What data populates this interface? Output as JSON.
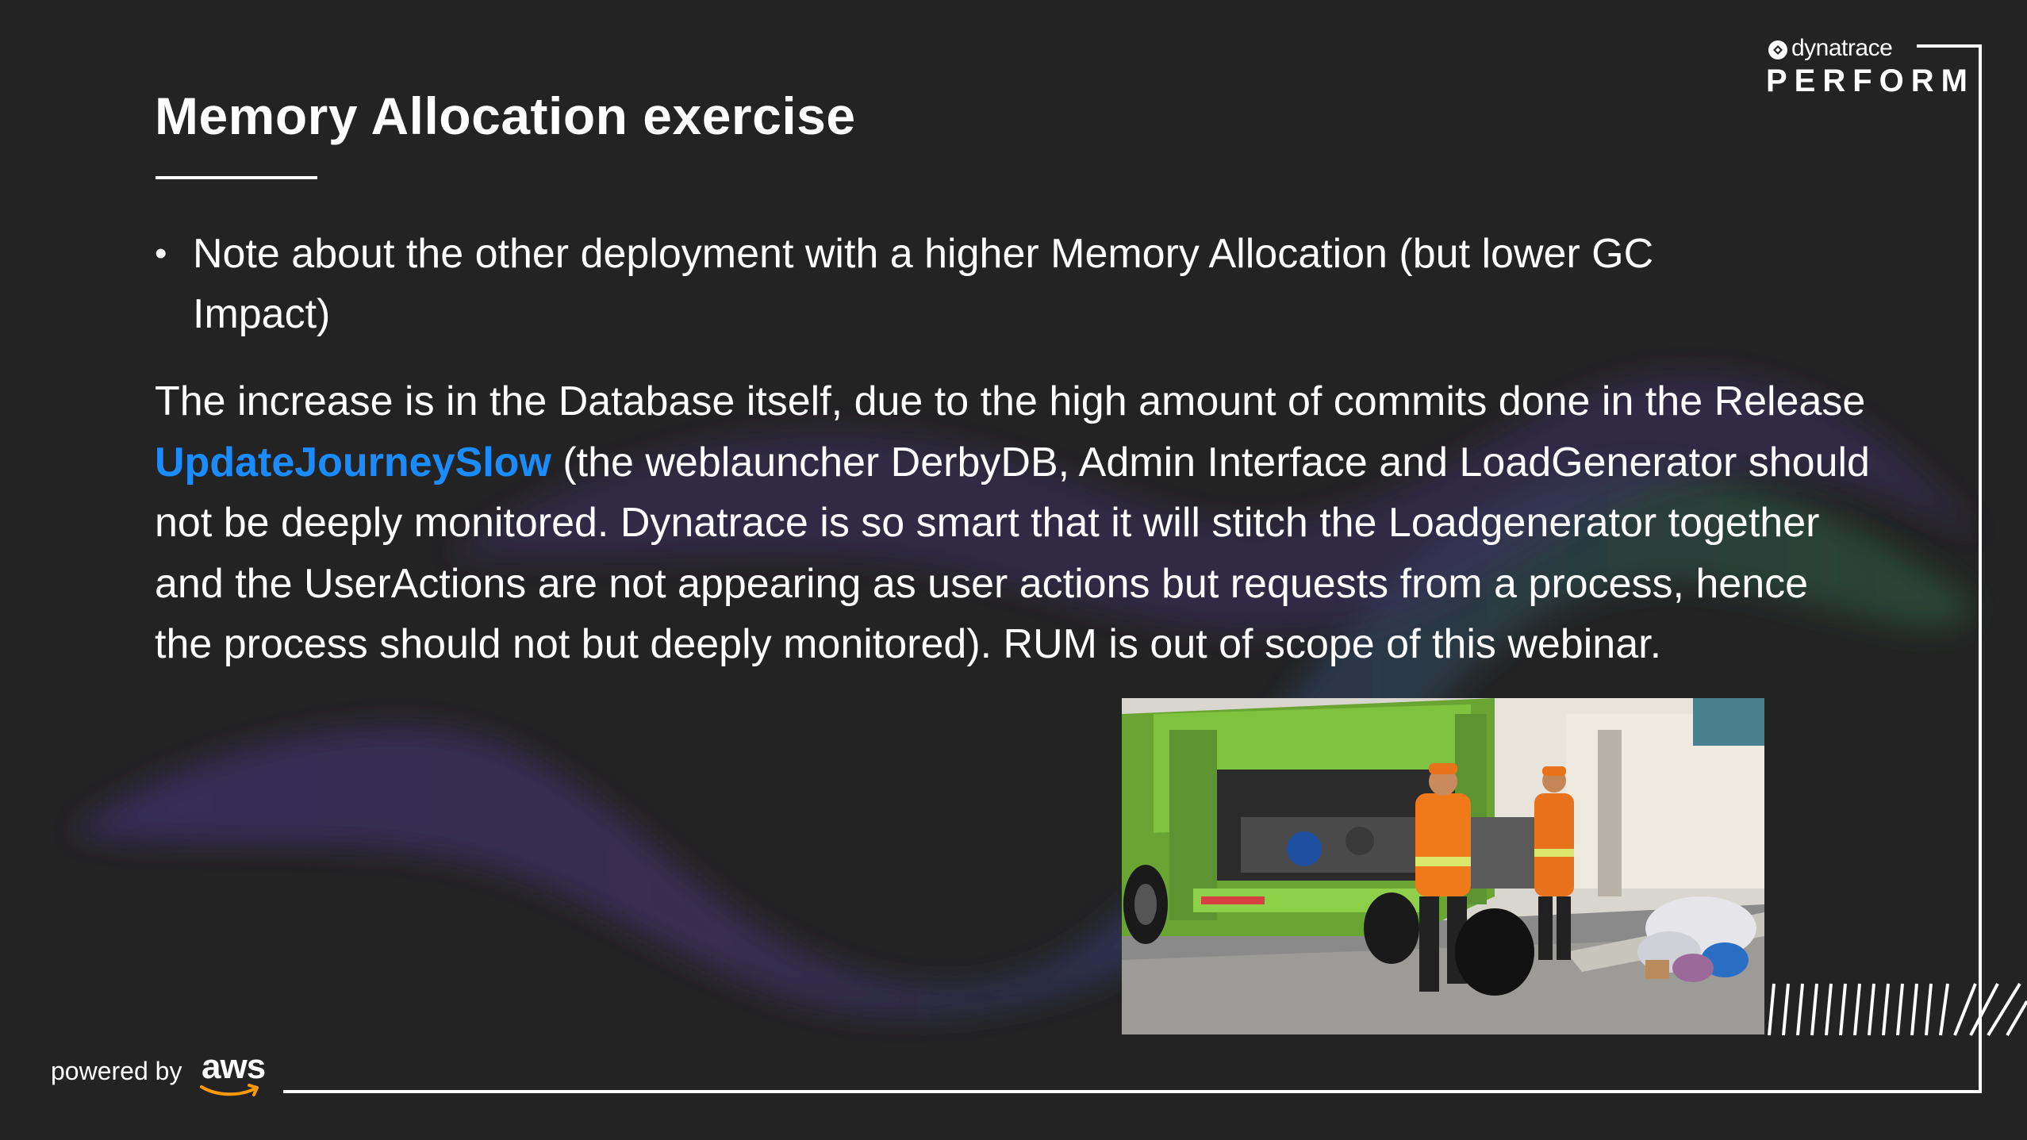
{
  "slide": {
    "title": "Memory Allocation exercise",
    "bullets": [
      "Note about the other deployment with a higher Memory Allocation (but lower GC Impact)"
    ],
    "paragraph": {
      "before": "The increase is in the Database itself, due to the high amount of commits done in the Release ",
      "highlight": "UpdateJourneySlow",
      "after": " (the weblauncher DerbyDB, Admin Interface and LoadGenerator should not  be deeply monitored. Dynatrace is so smart that it will stitch the Loadgenerator together and the UserActions are not appearing as user actions but requests from a process, hence the process should not but deeply monitored). RUM is out of scope of this webinar."
    }
  },
  "logo": {
    "brand": "dynatrace",
    "event": "PERFORM"
  },
  "footer": {
    "powered_by": "powered by",
    "partner": "aws"
  },
  "colors": {
    "background": "#232323",
    "highlight": "#1a8cff",
    "text": "#ffffff"
  },
  "photo": {
    "icon": "garbage-collection-photo"
  }
}
